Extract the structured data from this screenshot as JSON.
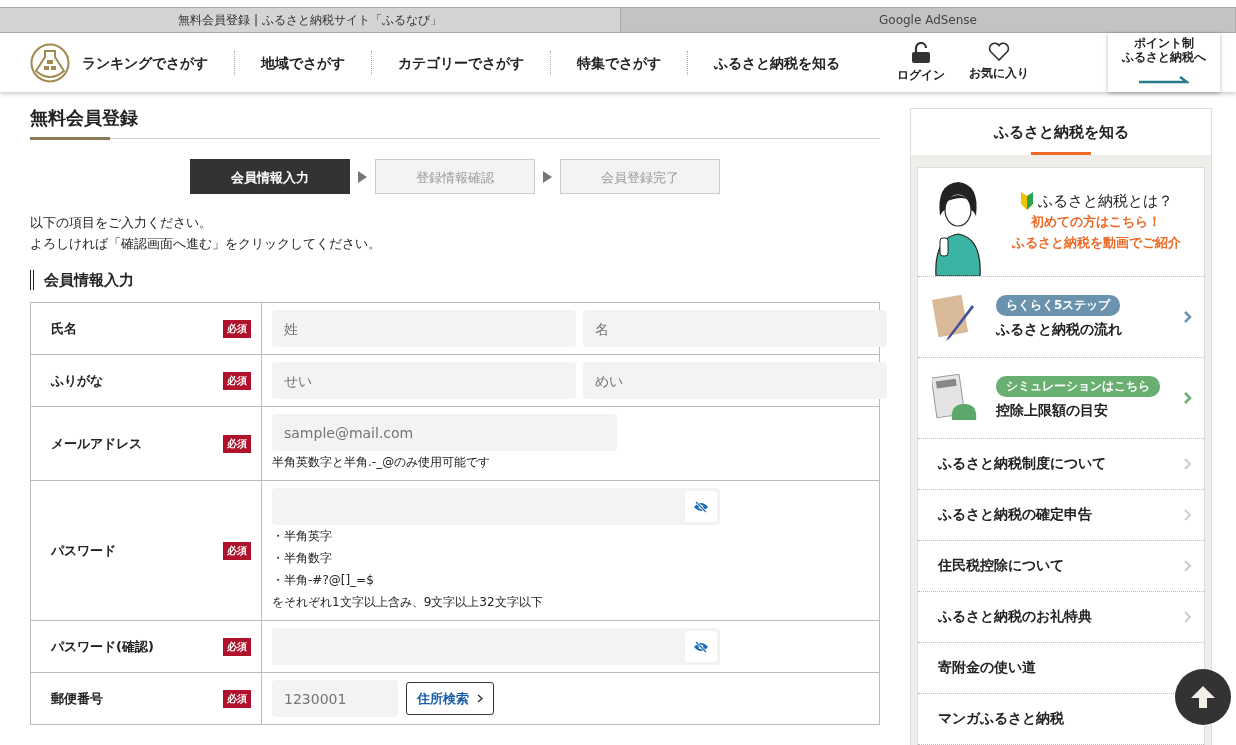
{
  "browser_tabs": [
    {
      "title": "無料会員登録 | ふるさと納税サイト「ふるなび」",
      "selected": true
    },
    {
      "title": "Google AdSense",
      "selected": false
    }
  ],
  "header": {
    "nav": [
      "ランキングでさがす",
      "地域でさがす",
      "カテゴリーでさがす",
      "特集でさがす",
      "ふるさと納税を知る"
    ],
    "actions": [
      {
        "kind": "login",
        "label": "ログイン"
      },
      {
        "kind": "favorite",
        "label": "お気に入り"
      }
    ],
    "point_button": [
      "ポイント制",
      "ふるさと納税へ"
    ]
  },
  "page_title": "無料会員登録",
  "steps": [
    {
      "label": "会員情報入力",
      "selected": true
    },
    {
      "label": "登録情報確認",
      "selected": false
    },
    {
      "label": "会員登録完了",
      "selected": false
    }
  ],
  "intro": [
    "以下の項目をご入力ください。",
    "よろしければ「確認画面へ進む」をクリックしてください。"
  ],
  "section_title": "会員情報入力",
  "form": [
    {
      "label": "氏名",
      "badge": "必須",
      "kind": "pair",
      "fields": [
        {
          "placeholder": "姓"
        },
        {
          "placeholder": "名"
        }
      ]
    },
    {
      "label": "ふりがな",
      "badge": "必須",
      "kind": "pair",
      "fields": [
        {
          "placeholder": "せい"
        },
        {
          "placeholder": "めい"
        }
      ]
    },
    {
      "label": "メールアドレス",
      "badge": "必須",
      "kind": "single",
      "fields": [
        {
          "placeholder": "sample@mail.com"
        }
      ],
      "notes": [
        "半角英数字と半角.-_@のみ使用可能です"
      ]
    },
    {
      "label": "パスワード",
      "badge": "必須",
      "kind": "password",
      "notes": [
        "・半角英字",
        "・半角数字",
        "・半角-#?@[]_=$",
        "をそれぞれ1文字以上含み、9文字以上32文字以下"
      ]
    },
    {
      "label": "パスワード(確認)",
      "badge": "必須",
      "kind": "password"
    },
    {
      "label": "郵便番号",
      "badge": "必須",
      "kind": "postal",
      "fields": [
        {
          "placeholder": "1230001"
        }
      ],
      "button": "住所検索"
    }
  ],
  "sidebar": {
    "title": "ふるさと納税を知る",
    "banner": {
      "heading": "ふるさと納税とは？",
      "line1": "初めての方はこちら！",
      "line2": "ふるさと納税を動画でご紹介"
    },
    "features": [
      {
        "kind": "envelope",
        "badge": "らくらく5ステップ",
        "title": "ふるさと納税の流れ",
        "color": "#6b93ad"
      },
      {
        "kind": "calculator",
        "badge": "シミュレーションはこちら",
        "title": "控除上限額の目安",
        "color": "#6aaf72"
      }
    ],
    "links": [
      "ふるさと納税制度について",
      "ふるさと納税の確定申告",
      "住民税控除について",
      "ふるさと納税のお礼特典",
      "寄附金の使い道",
      "マンガふるさと納税"
    ]
  }
}
